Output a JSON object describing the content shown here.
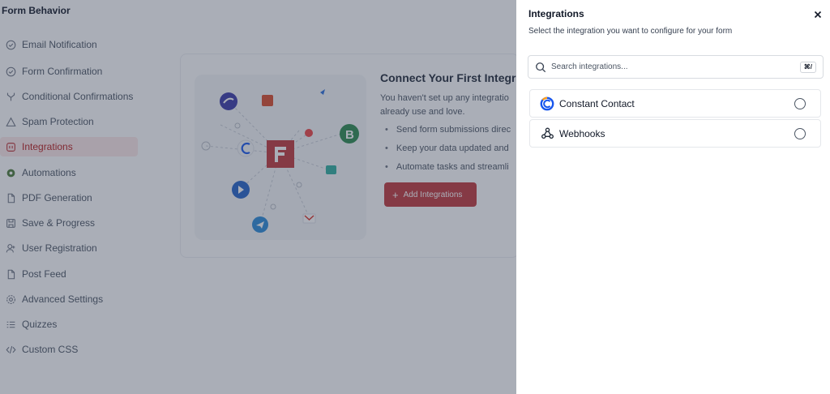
{
  "page": {
    "title": "Form Behavior"
  },
  "sidebar": {
    "items": [
      {
        "label": "Email Notification",
        "icon": "check-circle-icon",
        "active": false
      },
      {
        "label": "Form Confirmation",
        "icon": "check-circle-icon",
        "active": false
      },
      {
        "label": "Conditional Confirmations",
        "icon": "branch-icon",
        "active": false
      },
      {
        "label": "Spam Protection",
        "icon": "warning-triangle-icon",
        "active": false
      },
      {
        "label": "Integrations",
        "icon": "plug-icon",
        "active": true
      },
      {
        "label": "Automations",
        "icon": "gear-icon",
        "active": false
      },
      {
        "label": "PDF Generation",
        "icon": "document-icon",
        "active": false
      },
      {
        "label": "Save & Progress",
        "icon": "save-icon",
        "active": false
      },
      {
        "label": "User Registration",
        "icon": "user-add-icon",
        "active": false
      },
      {
        "label": "Post Feed",
        "icon": "document-icon",
        "active": false
      },
      {
        "label": "Advanced Settings",
        "icon": "settings-icon",
        "active": false
      },
      {
        "label": "Quizzes",
        "icon": "list-icon",
        "active": false
      },
      {
        "label": "Custom CSS",
        "icon": "code-icon",
        "active": false
      }
    ]
  },
  "empty_state": {
    "title": "Connect Your First Integra",
    "description": "You haven't set up any integratio already use and love.",
    "bullets": [
      "Send form submissions direc",
      "Keep your data updated and",
      "Automate tasks and streamli"
    ],
    "button_label": "Add Integrations"
  },
  "drawer": {
    "title": "Integrations",
    "subtitle": "Select the integration you want to configure for your form",
    "search": {
      "placeholder": "Search integrations...",
      "shortcut": "⌘/"
    },
    "options": [
      {
        "label": "Constant Contact",
        "icon": "constant-contact-icon",
        "selected": false
      },
      {
        "label": "Webhooks",
        "icon": "webhooks-icon",
        "selected": false
      }
    ]
  },
  "colors": {
    "accent": "#c0383b",
    "overlay": "#343e54",
    "active_nav_bg": "#fde8e8",
    "constant_contact_blue": "#1856ed",
    "constant_contact_orange": "#ff9e1b"
  }
}
